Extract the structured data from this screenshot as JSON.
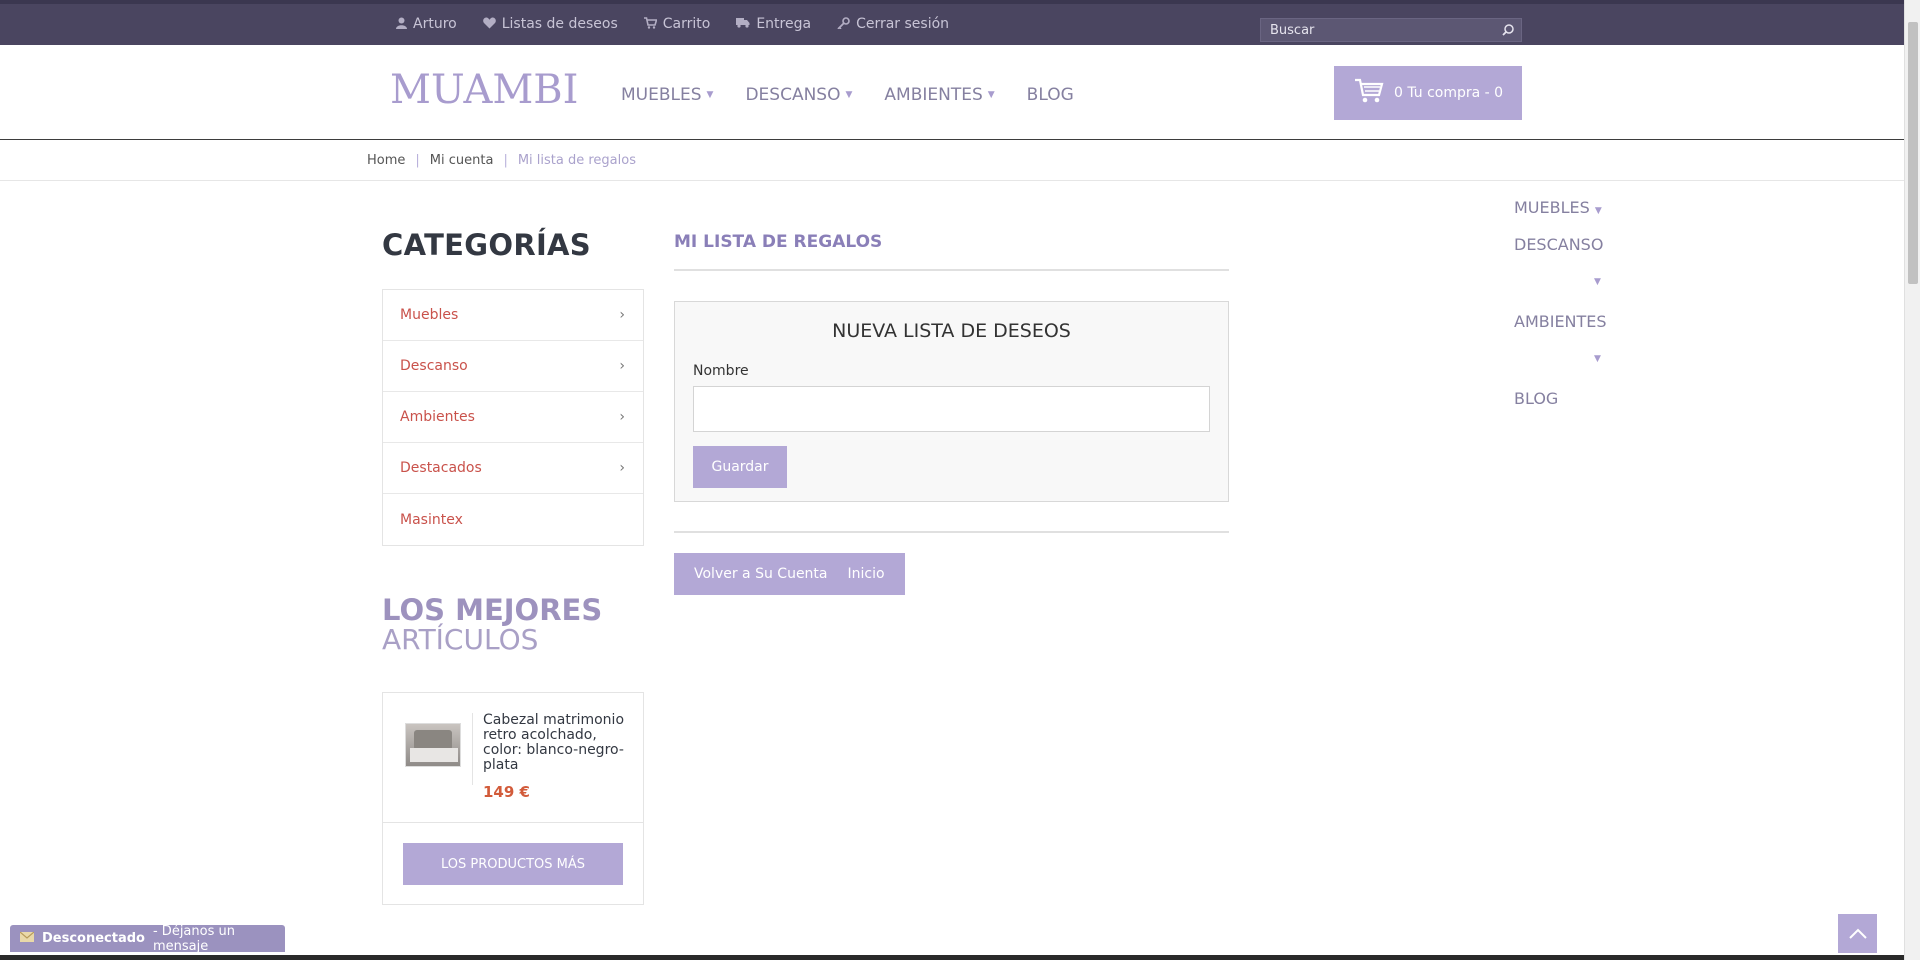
{
  "topbar": {
    "links": [
      {
        "label": "Arturo",
        "icon": "user-icon"
      },
      {
        "label": "Listas de deseos",
        "icon": "heart-icon"
      },
      {
        "label": "Carrito",
        "icon": "cart-icon"
      },
      {
        "label": "Entrega",
        "icon": "truck-icon"
      },
      {
        "label": "Cerrar sesión",
        "icon": "key-icon"
      }
    ],
    "search_placeholder": "Buscar"
  },
  "header": {
    "logo": "MUAMBI",
    "nav": [
      "MUEBLES",
      "DESCANSO",
      "AMBIENTES",
      "BLOG"
    ],
    "cart_label": "0 Tu compra - 0"
  },
  "breadcrumb": {
    "items": [
      "Home",
      "Mi cuenta",
      "Mi lista de regalos"
    ],
    "separator": "|"
  },
  "sidebar": {
    "categories_title": "CATEGORÍAS",
    "categories": [
      "Muebles",
      "Descanso",
      "Ambientes",
      "Destacados",
      "Masintex"
    ],
    "best_title_1": "LOS MEJORES",
    "best_title_2": "ARTÍCULOS",
    "product": {
      "name": "Cabezal matrimonio retro acolchado, color: blanco-negro-plata",
      "price": "149 €"
    },
    "more_button": "LOS PRODUCTOS MÁS"
  },
  "main": {
    "heading": "MI LISTA DE REGALOS",
    "form_title": "NUEVA LISTA DE DESEOS",
    "name_label": "Nombre",
    "name_value": "",
    "save_button": "Guardar",
    "back_button": "Volver a Su Cuenta",
    "home_button": "Inicio"
  },
  "right_nav": [
    "MUEBLES",
    "DESCANSO",
    "AMBIENTES",
    "BLOG"
  ],
  "chat": {
    "status": "Desconectado",
    "message": "- Déjanos un mensaje"
  },
  "colors": {
    "accent": "#b3a8d6",
    "topbar": "#4a4560",
    "category_link": "#c9524b",
    "price": "#d25b3a"
  }
}
